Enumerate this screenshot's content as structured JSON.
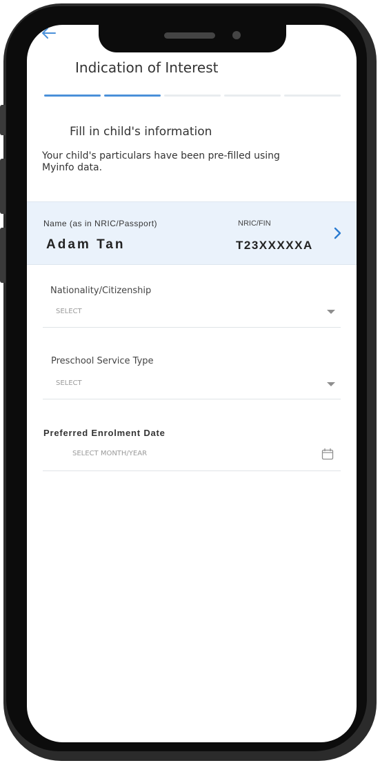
{
  "header": {
    "title": "Indication of Interest",
    "back_icon": "arrow-left-icon",
    "progress": {
      "total_steps": 5,
      "current_step": 2
    }
  },
  "section": {
    "title": "Fill in child's information",
    "description": "Your child's particulars have been pre-filled using Myinfo data."
  },
  "child_card": {
    "name_label": "Name (as in NRIC/Passport)",
    "name_value": "Adam Tan",
    "nric_label": "NRIC/FIN",
    "nric_value": "T23XXXXXA",
    "chevron_icon": "chevron-right-icon"
  },
  "fields": {
    "nationality": {
      "label": "Nationality/Citizenship",
      "value": "SELECT",
      "icon": "caret-down-icon"
    },
    "service_type": {
      "label": "Preschool Service Type",
      "value": "SELECT",
      "icon": "caret-down-icon"
    },
    "enrolment_date": {
      "label": "Preferred Enrolment Date",
      "value": "SELECT MONTH/YEAR",
      "icon": "calendar-icon"
    }
  },
  "colors": {
    "accent": "#4a90d9",
    "card_bg": "#eaf2fb",
    "chevron": "#2a7bd1"
  }
}
